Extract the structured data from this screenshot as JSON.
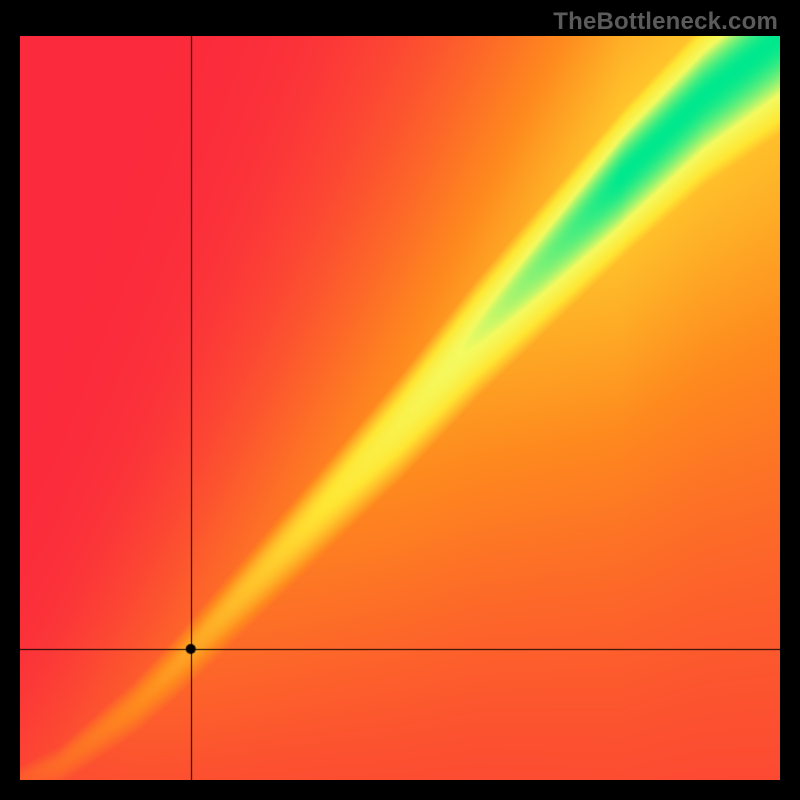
{
  "watermark": "TheBottleneck.com",
  "chart_data": {
    "type": "heatmap",
    "title": "",
    "xlabel": "",
    "ylabel": "",
    "xrange": [
      0,
      1
    ],
    "yrange": [
      0,
      1
    ],
    "crosshair": {
      "x": 0.225,
      "y": 0.175
    },
    "marker": {
      "x": 0.225,
      "y": 0.175,
      "label": ""
    },
    "optimal_curve": {
      "description": "green ridge where value is optimal; roughly y = x with slight nonlinearity near origin",
      "points": [
        {
          "x": 0.0,
          "y": 0.0
        },
        {
          "x": 0.05,
          "y": 0.02
        },
        {
          "x": 0.1,
          "y": 0.06
        },
        {
          "x": 0.15,
          "y": 0.1
        },
        {
          "x": 0.2,
          "y": 0.15
        },
        {
          "x": 0.3,
          "y": 0.26
        },
        {
          "x": 0.4,
          "y": 0.37
        },
        {
          "x": 0.5,
          "y": 0.48
        },
        {
          "x": 0.6,
          "y": 0.6
        },
        {
          "x": 0.7,
          "y": 0.71
        },
        {
          "x": 0.8,
          "y": 0.82
        },
        {
          "x": 0.9,
          "y": 0.92
        },
        {
          "x": 1.0,
          "y": 1.0
        }
      ],
      "band_half_width_at_x0": 0.015,
      "band_half_width_at_x1": 0.08
    },
    "color_scale": {
      "low": "#fb2a3c",
      "mid_low": "#fe8a1e",
      "mid": "#ffe633",
      "mid_high": "#f4fa60",
      "high": "#00e88d"
    }
  }
}
